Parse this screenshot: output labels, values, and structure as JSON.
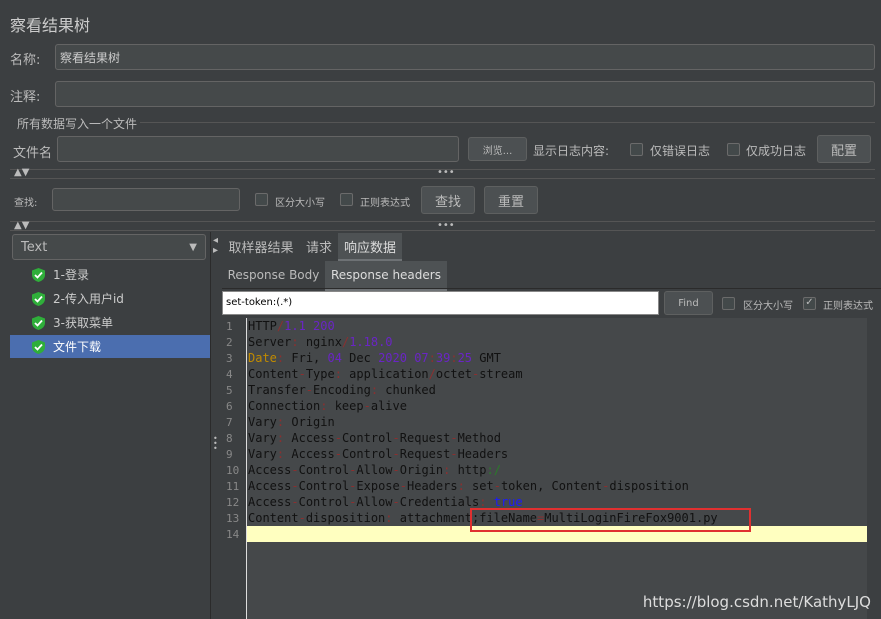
{
  "title": "察看结果树",
  "name_label": "名称:",
  "name_value": "察看结果树",
  "comment_label": "注释:",
  "comment_value": "",
  "file_section": "所有数据写入一个文件",
  "file_label": "文件名",
  "file_value": "",
  "browse": "浏览...",
  "log_label": "显示日志内容:",
  "errors_only": "仅错误日志",
  "success_only": "仅成功日志",
  "configure": "配置",
  "search_label": "查找:",
  "search_value": "",
  "case_sensitive": "区分大小写",
  "regex": "正则表达式",
  "find_btn": "查找",
  "reset_btn": "重置",
  "renderer": "Text",
  "tree": [
    {
      "label": "1-登录"
    },
    {
      "label": "2-传入用户id"
    },
    {
      "label": "3-获取菜单"
    },
    {
      "label": "文件下载",
      "selected": true
    }
  ],
  "tabs": [
    {
      "label": "取样器结果"
    },
    {
      "label": "请求"
    },
    {
      "label": "响应数据",
      "active": true
    }
  ],
  "subtabs": [
    {
      "label": "Response Body"
    },
    {
      "label": "Response headers",
      "active": true
    }
  ],
  "resp_search_value": "set-token:(.*)",
  "resp_find": "Find",
  "resp_case": "区分大小写",
  "resp_regex": "正则表达式",
  "resp_case_checked": false,
  "resp_regex_checked": true,
  "lines": [
    [
      [
        "HTTP",
        ""
      ],
      [
        "/",
        "p"
      ],
      [
        "1.1 200",
        "n"
      ]
    ],
    [
      [
        "Server",
        ""
      ],
      [
        ":",
        "p"
      ],
      [
        " nginx",
        ""
      ],
      [
        "/",
        "p"
      ],
      [
        "1.18.0",
        "n"
      ]
    ],
    [
      [
        "Date",
        "k"
      ],
      [
        ":",
        "p"
      ],
      [
        " Fri, ",
        ""
      ],
      [
        "04",
        "n"
      ],
      [
        " Dec ",
        ""
      ],
      [
        "2020 07",
        "n"
      ],
      [
        ":",
        "p"
      ],
      [
        "39",
        "n"
      ],
      [
        ":",
        "p"
      ],
      [
        "25",
        "n"
      ],
      [
        " GMT",
        ""
      ]
    ],
    [
      [
        "Content",
        ""
      ],
      [
        "-",
        "p"
      ],
      [
        "Type",
        ""
      ],
      [
        ":",
        "p"
      ],
      [
        " application",
        ""
      ],
      [
        "/",
        "p"
      ],
      [
        "octet",
        ""
      ],
      [
        "-",
        "p"
      ],
      [
        "stream",
        ""
      ]
    ],
    [
      [
        "Transfer",
        ""
      ],
      [
        "-",
        "p"
      ],
      [
        "Encoding",
        ""
      ],
      [
        ":",
        "p"
      ],
      [
        " chunked",
        ""
      ]
    ],
    [
      [
        "Connection",
        ""
      ],
      [
        ":",
        "p"
      ],
      [
        " keep",
        ""
      ],
      [
        "-",
        "p"
      ],
      [
        "alive",
        ""
      ]
    ],
    [
      [
        "Vary",
        ""
      ],
      [
        ":",
        "p"
      ],
      [
        " Origin",
        ""
      ]
    ],
    [
      [
        "Vary",
        ""
      ],
      [
        ":",
        "p"
      ],
      [
        " Access",
        ""
      ],
      [
        "-",
        "p"
      ],
      [
        "Control",
        ""
      ],
      [
        "-",
        "p"
      ],
      [
        "Request",
        ""
      ],
      [
        "-",
        "p"
      ],
      [
        "Method",
        ""
      ]
    ],
    [
      [
        "Vary",
        ""
      ],
      [
        ":",
        "p"
      ],
      [
        " Access",
        ""
      ],
      [
        "-",
        "p"
      ],
      [
        "Control",
        ""
      ],
      [
        "-",
        "p"
      ],
      [
        "Request",
        ""
      ],
      [
        "-",
        "p"
      ],
      [
        "Headers",
        ""
      ]
    ],
    [
      [
        "Access",
        ""
      ],
      [
        "-",
        "p"
      ],
      [
        "Control",
        ""
      ],
      [
        "-",
        "p"
      ],
      [
        "Allow",
        ""
      ],
      [
        "-",
        "p"
      ],
      [
        "Origin",
        ""
      ],
      [
        ":",
        "p"
      ],
      [
        " http",
        ""
      ],
      [
        ":/",
        "g"
      ]
    ],
    [
      [
        "Access",
        ""
      ],
      [
        "-",
        "p"
      ],
      [
        "Control",
        ""
      ],
      [
        "-",
        "p"
      ],
      [
        "Expose",
        ""
      ],
      [
        "-",
        "p"
      ],
      [
        "Headers",
        ""
      ],
      [
        ":",
        "p"
      ],
      [
        " set",
        ""
      ],
      [
        "-",
        "p"
      ],
      [
        "token, Content",
        ""
      ],
      [
        "-",
        "p"
      ],
      [
        "disposition",
        ""
      ]
    ],
    [
      [
        "Access",
        ""
      ],
      [
        "-",
        "p"
      ],
      [
        "Control",
        ""
      ],
      [
        "-",
        "p"
      ],
      [
        "Allow",
        ""
      ],
      [
        "-",
        "p"
      ],
      [
        "Credentials",
        ""
      ],
      [
        ":",
        "p"
      ],
      [
        " ",
        ""
      ],
      [
        "true",
        "b"
      ]
    ],
    [
      [
        "Content",
        ""
      ],
      [
        "-",
        "p"
      ],
      [
        "disposition",
        ""
      ],
      [
        ":",
        "p"
      ],
      [
        " attachment;fileName",
        ""
      ],
      [
        "=",
        "p"
      ],
      [
        "MultiLoginFireFox9001.py",
        ""
      ]
    ],
    []
  ],
  "watermark": "https://blog.csdn.net/KathyLJQ"
}
